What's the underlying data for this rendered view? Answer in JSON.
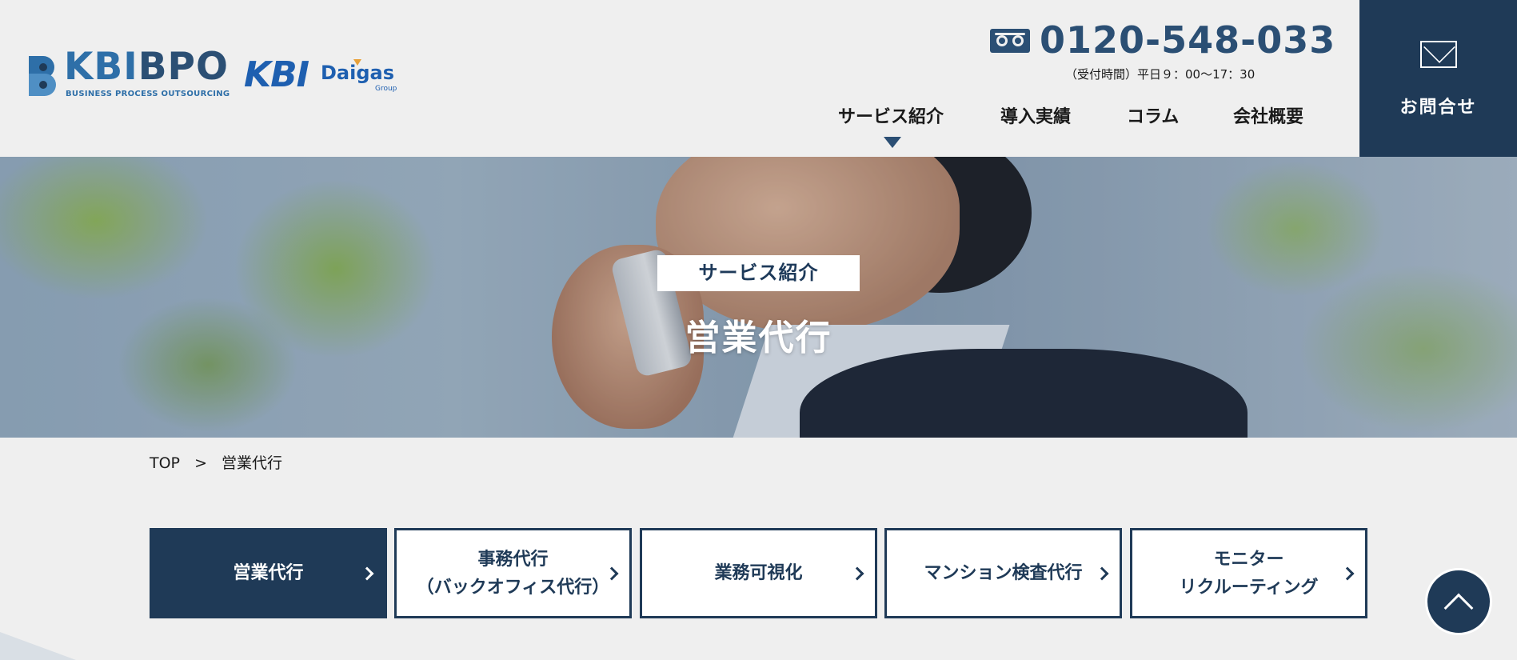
{
  "header": {
    "logo_primary": {
      "kbi": "KBI",
      "bpo": "BPO",
      "subtitle": "BUSINESS PROCESS OUTSOURCING"
    },
    "logo_secondary": {
      "kbi": "KBI",
      "daigas": "Daigas",
      "group": "Group"
    },
    "phone": {
      "icon": "free-dial-icon",
      "number": "0120-548-033",
      "hours": "（受付時間）平日９：00〜17：30"
    },
    "nav": [
      {
        "label": "サービス紹介",
        "active": true
      },
      {
        "label": "導入実績"
      },
      {
        "label": "コラム"
      },
      {
        "label": "会社概要"
      }
    ],
    "contact": {
      "icon": "mail-icon",
      "label": "お問合せ"
    }
  },
  "hero": {
    "tag": "サービス紹介",
    "title": "営業代行"
  },
  "breadcrumb": {
    "items": [
      "TOP",
      ">",
      "営業代行"
    ]
  },
  "service_tabs": [
    {
      "label": "営業代行",
      "active": true
    },
    {
      "label": "事務代行\n（バックオフィス代行）"
    },
    {
      "label": "業務可視化"
    },
    {
      "label": "マンション検査代行"
    },
    {
      "label": "モニター\nリクルーティング"
    }
  ],
  "colors": {
    "primary": "#1f3a57",
    "accent": "#2e6fa8",
    "background": "#efefef"
  },
  "page_top": {
    "icon": "chevron-up-icon"
  }
}
